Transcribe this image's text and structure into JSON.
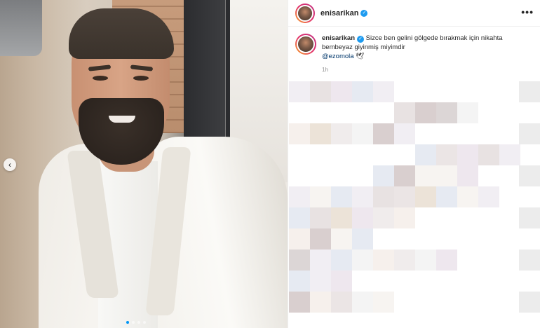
{
  "post": {
    "username": "enisarikan",
    "verified_icon": "verified-badge-icon",
    "more_label": "•••",
    "caption_text": "Sizce ben gelini gölgede bırakmak için nikahta bembeyaz giyinmiş miyimdir",
    "mention": "@ezomola",
    "caption_emoji": "🕊",
    "time": "1h"
  },
  "carousel": {
    "prev_label": "‹",
    "dot_count": 4,
    "active_dot": 1
  },
  "colors": {
    "verified_blue": "#1d9bf0",
    "mention_blue": "#00376b",
    "meta_gray": "#8e8e8e"
  }
}
